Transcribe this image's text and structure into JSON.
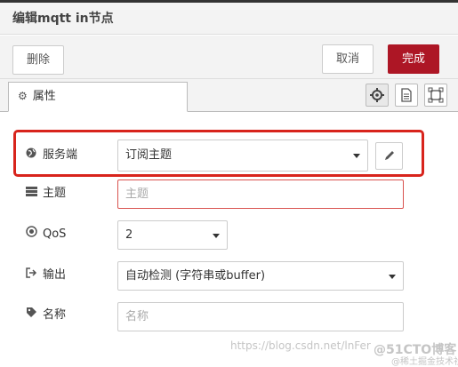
{
  "dialog": {
    "title": "编辑mqtt in节点"
  },
  "toolbar": {
    "delete_label": "删除",
    "cancel_label": "取消",
    "done_label": "完成"
  },
  "tabs": {
    "properties_label": "属性"
  },
  "form": {
    "server": {
      "label": "服务端",
      "value": "订阅主题"
    },
    "topic": {
      "label": "主题",
      "placeholder": "主题"
    },
    "qos": {
      "label": "QoS",
      "value": "2"
    },
    "output": {
      "label": "输出",
      "value": "自动检测 (字符串或buffer)"
    },
    "name": {
      "label": "名称",
      "placeholder": "名称"
    }
  },
  "watermark": {
    "url": "https://blog.csdn.net/lnFer",
    "site": "@51CTO博客",
    "sub": "@稀土掘金技术社区"
  },
  "colors": {
    "done_button": "#ad1625",
    "highlight_box": "#d8241c",
    "topic_border": "#d9534f"
  }
}
